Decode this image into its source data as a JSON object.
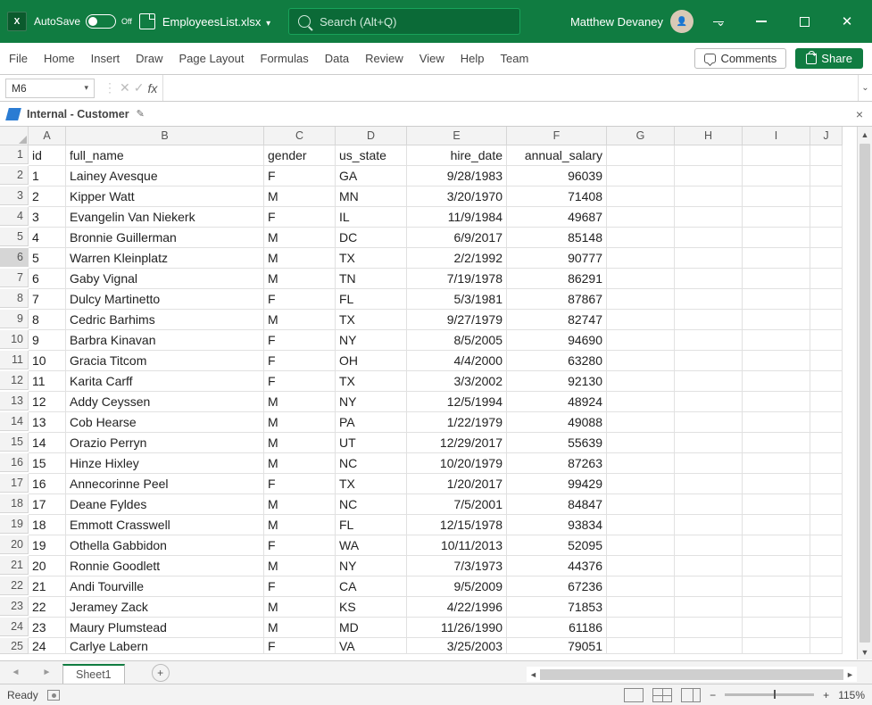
{
  "titlebar": {
    "autosave_label": "AutoSave",
    "autosave_state": "Off",
    "filename": "EmployeesList.xlsx",
    "search_placeholder": "Search (Alt+Q)",
    "username": "Matthew Devaney"
  },
  "ribbon": {
    "tabs": [
      "File",
      "Home",
      "Insert",
      "Draw",
      "Page Layout",
      "Formulas",
      "Data",
      "Review",
      "View",
      "Help",
      "Team"
    ],
    "comments_label": "Comments",
    "share_label": "Share"
  },
  "namebox": {
    "value": "M6"
  },
  "sensitivity": {
    "label": "Internal - Customer"
  },
  "columns": [
    "A",
    "B",
    "C",
    "D",
    "E",
    "F",
    "G",
    "H",
    "I",
    "J"
  ],
  "headers": {
    "A": "id",
    "B": "full_name",
    "C": "gender",
    "D": "us_state",
    "E": "hire_date",
    "F": "annual_salary"
  },
  "rows": [
    {
      "n": 1,
      "id": "1",
      "name": "Lainey Avesque",
      "g": "F",
      "st": "GA",
      "hd": "9/28/1983",
      "sal": "96039"
    },
    {
      "n": 2,
      "id": "2",
      "name": "Kipper Watt",
      "g": "M",
      "st": "MN",
      "hd": "3/20/1970",
      "sal": "71408"
    },
    {
      "n": 3,
      "id": "3",
      "name": "Evangelin Van Niekerk",
      "g": "F",
      "st": "IL",
      "hd": "11/9/1984",
      "sal": "49687"
    },
    {
      "n": 4,
      "id": "4",
      "name": "Bronnie Guillerman",
      "g": "M",
      "st": "DC",
      "hd": "6/9/2017",
      "sal": "85148"
    },
    {
      "n": 5,
      "id": "5",
      "name": "Warren Kleinplatz",
      "g": "M",
      "st": "TX",
      "hd": "2/2/1992",
      "sal": "90777"
    },
    {
      "n": 6,
      "id": "6",
      "name": "Gaby Vignal",
      "g": "M",
      "st": "TN",
      "hd": "7/19/1978",
      "sal": "86291"
    },
    {
      "n": 7,
      "id": "7",
      "name": "Dulcy Martinetto",
      "g": "F",
      "st": "FL",
      "hd": "5/3/1981",
      "sal": "87867"
    },
    {
      "n": 8,
      "id": "8",
      "name": "Cedric Barhims",
      "g": "M",
      "st": "TX",
      "hd": "9/27/1979",
      "sal": "82747"
    },
    {
      "n": 9,
      "id": "9",
      "name": "Barbra Kinavan",
      "g": "F",
      "st": "NY",
      "hd": "8/5/2005",
      "sal": "94690"
    },
    {
      "n": 10,
      "id": "10",
      "name": "Gracia Titcom",
      "g": "F",
      "st": "OH",
      "hd": "4/4/2000",
      "sal": "63280"
    },
    {
      "n": 11,
      "id": "11",
      "name": "Karita Carff",
      "g": "F",
      "st": "TX",
      "hd": "3/3/2002",
      "sal": "92130"
    },
    {
      "n": 12,
      "id": "12",
      "name": "Addy Ceyssen",
      "g": "M",
      "st": "NY",
      "hd": "12/5/1994",
      "sal": "48924"
    },
    {
      "n": 13,
      "id": "13",
      "name": "Cob Hearse",
      "g": "M",
      "st": "PA",
      "hd": "1/22/1979",
      "sal": "49088"
    },
    {
      "n": 14,
      "id": "14",
      "name": "Orazio Perryn",
      "g": "M",
      "st": "UT",
      "hd": "12/29/2017",
      "sal": "55639"
    },
    {
      "n": 15,
      "id": "15",
      "name": "Hinze Hixley",
      "g": "M",
      "st": "NC",
      "hd": "10/20/1979",
      "sal": "87263"
    },
    {
      "n": 16,
      "id": "16",
      "name": "Annecorinne Peel",
      "g": "F",
      "st": "TX",
      "hd": "1/20/2017",
      "sal": "99429"
    },
    {
      "n": 17,
      "id": "17",
      "name": "Deane Fyldes",
      "g": "M",
      "st": "NC",
      "hd": "7/5/2001",
      "sal": "84847"
    },
    {
      "n": 18,
      "id": "18",
      "name": "Emmott Crasswell",
      "g": "M",
      "st": "FL",
      "hd": "12/15/1978",
      "sal": "93834"
    },
    {
      "n": 19,
      "id": "19",
      "name": "Othella Gabbidon",
      "g": "F",
      "st": "WA",
      "hd": "10/11/2013",
      "sal": "52095"
    },
    {
      "n": 20,
      "id": "20",
      "name": "Ronnie Goodlett",
      "g": "M",
      "st": "NY",
      "hd": "7/3/1973",
      "sal": "44376"
    },
    {
      "n": 21,
      "id": "21",
      "name": "Andi Tourville",
      "g": "F",
      "st": "CA",
      "hd": "9/5/2009",
      "sal": "67236"
    },
    {
      "n": 22,
      "id": "22",
      "name": "Jeramey Zack",
      "g": "M",
      "st": "KS",
      "hd": "4/22/1996",
      "sal": "71853"
    },
    {
      "n": 23,
      "id": "23",
      "name": "Maury Plumstead",
      "g": "M",
      "st": "MD",
      "hd": "11/26/1990",
      "sal": "61186"
    },
    {
      "n": 24,
      "id": "24",
      "name": "Carlye Labern",
      "g": "F",
      "st": "VA",
      "hd": "3/25/2003",
      "sal": "79051"
    }
  ],
  "selected_row_header": 6,
  "sheettab": {
    "name": "Sheet1"
  },
  "statusbar": {
    "ready": "Ready",
    "zoom": "115%"
  }
}
